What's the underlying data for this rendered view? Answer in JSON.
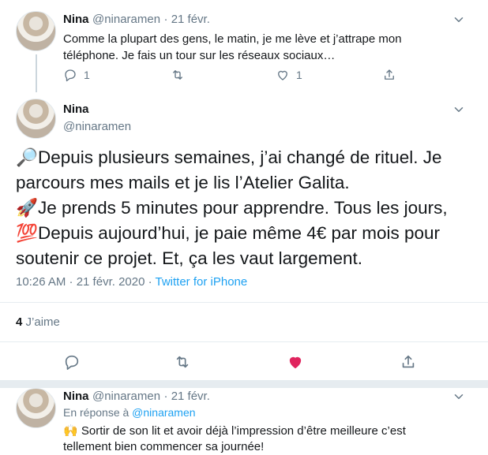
{
  "tweet1": {
    "name": "Nina",
    "handle": "@ninaramen",
    "date": "· 21 févr.",
    "text": "Comme la plupart des gens, le matin, je me lève et j’attrape mon téléphone. Je fais un tour sur les réseaux sociaux…",
    "reply_count": "1",
    "like_count": "1"
  },
  "tweet2": {
    "name": "Nina",
    "handle": "@ninaramen",
    "lines": [
      {
        "emoji": "🔎",
        "text": "Depuis plusieurs semaines, j’ai changé de rituel. Je"
      },
      {
        "emoji": "",
        "text": "parcours mes mails et je lis l’Atelier Galita."
      },
      {
        "emoji": "🚀",
        "text": "Je prends 5 minutes pour apprendre. Tous les jours,"
      },
      {
        "emoji": "💯",
        "text": "Depuis aujourd’hui, je paie même 4€ par mois pour"
      },
      {
        "emoji": "",
        "text": "soutenir ce projet. Et, ça les vaut largement."
      }
    ],
    "timestamp": "10:26 AM · 21 févr. 2020 · ",
    "source": "Twitter for iPhone",
    "likes_count": "4",
    "likes_label": "J’aime"
  },
  "tweet3": {
    "name": "Nina",
    "handle": "@ninaramen",
    "date": "· 21 févr.",
    "reply_prefix": "En réponse à ",
    "reply_to": "@ninaramen",
    "emoji": "🙌",
    "text_line1": " Sortir de son lit et avoir déjà l’impression d’être meilleure c’est",
    "text_line2": "tellement bien commencer sa journée!"
  },
  "colors": {
    "accent": "#1da1f2",
    "like": "#e0245e",
    "muted": "#657786",
    "divider": "#e6ecf0"
  }
}
